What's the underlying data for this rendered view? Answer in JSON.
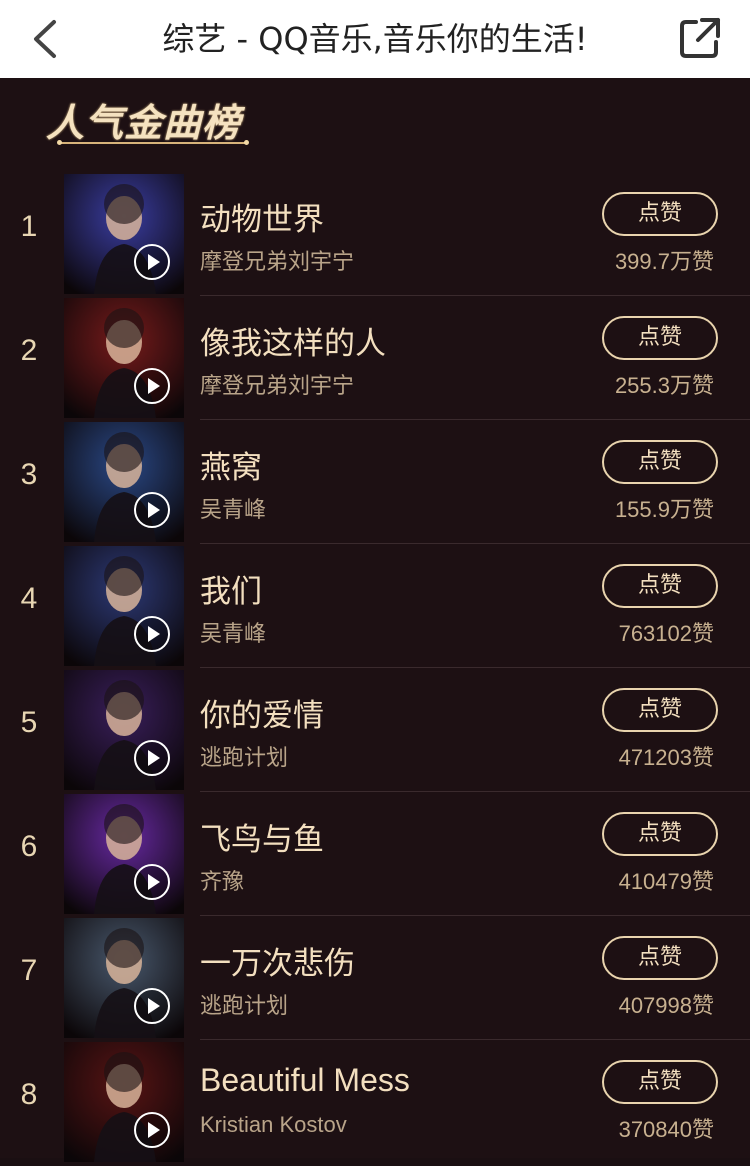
{
  "header": {
    "title": "综艺 - QQ音乐,音乐你的生活!",
    "back_icon": "chevron-left-icon",
    "share_icon": "share-external-icon"
  },
  "ranking": {
    "title": "人气金曲榜",
    "like_label": "点赞",
    "songs": [
      {
        "rank": "1",
        "name": "动物世界",
        "artist": "摩登兄弟刘宇宁",
        "likes": "399.7万赞",
        "cover_color": "#3b3fa8"
      },
      {
        "rank": "2",
        "name": "像我这样的人",
        "artist": "摩登兄弟刘宇宁",
        "likes": "255.3万赞",
        "cover_color": "#7a1b1b"
      },
      {
        "rank": "3",
        "name": "燕窝",
        "artist": "吴青峰",
        "likes": "155.9万赞",
        "cover_color": "#2a4a8a"
      },
      {
        "rank": "4",
        "name": "我们",
        "artist": "吴青峰",
        "likes": "763102赞",
        "cover_color": "#2d3b7a"
      },
      {
        "rank": "5",
        "name": "你的爱情",
        "artist": "逃跑计划",
        "likes": "471203赞",
        "cover_color": "#3a1f5e"
      },
      {
        "rank": "6",
        "name": "飞鸟与鱼",
        "artist": "齐豫",
        "likes": "410479赞",
        "cover_color": "#6a2aa8"
      },
      {
        "rank": "7",
        "name": "一万次悲伤",
        "artist": "逃跑计划",
        "likes": "407998赞",
        "cover_color": "#4a5b70"
      },
      {
        "rank": "8",
        "name": "Beautiful Mess",
        "artist": "Kristian Kostov",
        "likes": "370840赞",
        "cover_color": "#5a1414"
      }
    ]
  },
  "colors": {
    "background": "#1d1013",
    "gold_text": "#f3dfbf",
    "muted_text": "#b9a489"
  }
}
